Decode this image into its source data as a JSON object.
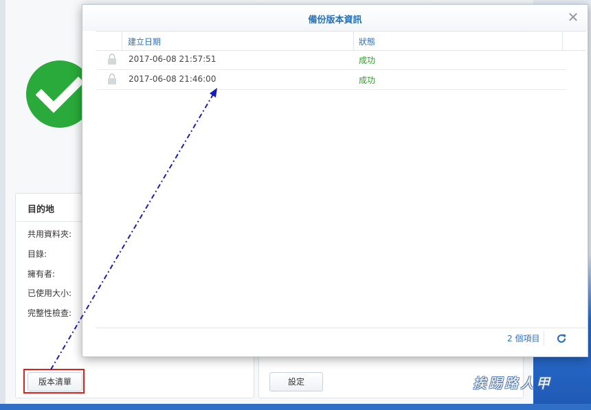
{
  "background": {
    "destination_title": "目的地",
    "labels": [
      "共用資料夾:",
      "目錄:",
      "擁有者:",
      "已使用大小:",
      "完整性檢查:"
    ],
    "version_list_button": "版本清單",
    "settings_button": "設定",
    "watermark": "挨踢路人甲",
    "status_color": "#2aaa3a"
  },
  "dialog": {
    "title": "備份版本資訊",
    "columns": {
      "date": "建立日期",
      "status": "狀態"
    },
    "rows": [
      {
        "date": "2017-06-08 21:57:51",
        "status": "成功"
      },
      {
        "date": "2017-06-08 21:46:00",
        "status": "成功"
      }
    ],
    "item_count": "2 個項目",
    "icons": {
      "close": "close-icon",
      "lock": "lock-icon",
      "refresh": "refresh-icon"
    }
  },
  "colors": {
    "accent": "#2a72c0",
    "success": "#2e9c2a",
    "highlight": "#e02020",
    "annotation_arrow": "#1a1ab8"
  }
}
